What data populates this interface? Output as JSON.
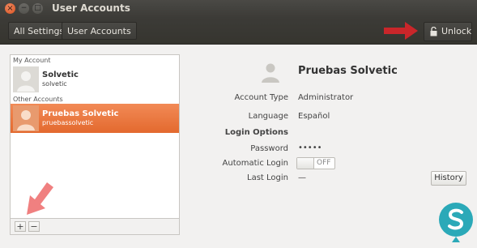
{
  "window": {
    "title": "User Accounts",
    "close_glyph": "×",
    "min_glyph": "−",
    "max_glyph": "□"
  },
  "toolbar": {
    "all_settings": "All Settings",
    "user_accounts": "User Accounts",
    "unlock": "Unlock",
    "unlock_icon": "lock-icon"
  },
  "sidebar": {
    "my_account_header": "My Account",
    "other_accounts_header": "Other Accounts",
    "accounts": [
      {
        "name": "Solvetic",
        "username": "solvetic",
        "selected": false
      },
      {
        "name": "Pruebas Solvetic",
        "username": "pruebassolvetic",
        "selected": true
      }
    ],
    "add_label": "+",
    "remove_label": "−"
  },
  "details": {
    "name": "Pruebas Solvetic",
    "account_type_label": "Account Type",
    "account_type_value": "Administrator",
    "language_label": "Language",
    "language_value": "Español",
    "login_options_label": "Login Options",
    "password_label": "Password",
    "password_value": "•••••",
    "automatic_login_label": "Automatic Login",
    "automatic_login_value": "OFF",
    "last_login_label": "Last Login",
    "last_login_value": "—",
    "history_button": "History"
  },
  "colors": {
    "accent_selected": "#e8743a",
    "annotation_arrow": "#c9262a",
    "annotation_arrow_light": "#f08080",
    "titlebar": "#3c3b37"
  }
}
